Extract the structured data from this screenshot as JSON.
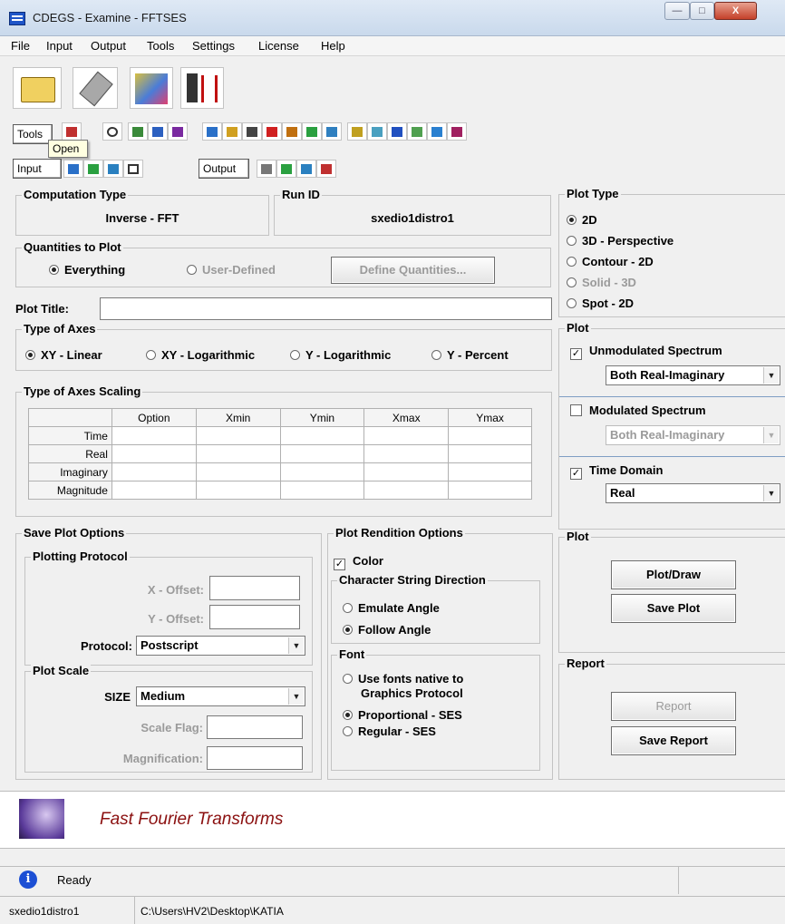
{
  "window": {
    "title": "CDEGS - Examine - FFTSES",
    "close_label": "X"
  },
  "menu": [
    "File",
    "Input",
    "Output",
    "Tools",
    "Settings",
    "License",
    "Help"
  ],
  "toolbar": {
    "tools_label": "Tools",
    "input_label": "Input",
    "output_label": "Output",
    "tooltip": "Open"
  },
  "computation_type": {
    "title": "Computation Type",
    "value": "Inverse - FFT"
  },
  "run_id": {
    "title": "Run ID",
    "value": "sxedio1distro1"
  },
  "quantities": {
    "title": "Quantities to Plot",
    "everything": "Everything",
    "user_defined": "User-Defined",
    "define_button": "Define Quantities..."
  },
  "plot_title": {
    "label": "Plot Title:",
    "value": ""
  },
  "axes_type": {
    "title": "Type of Axes",
    "options": [
      "XY - Linear",
      "XY - Logarithmic",
      "Y - Logarithmic",
      "Y - Percent"
    ]
  },
  "axes_scaling": {
    "title": "Type of Axes Scaling",
    "columns": [
      "",
      "Option",
      "Xmin",
      "Ymin",
      "Xmax",
      "Ymax"
    ],
    "rows": [
      "Time",
      "Real",
      "Imaginary",
      "Magnitude"
    ]
  },
  "plot_type": {
    "title": "Plot Type",
    "options": [
      "2D",
      "3D - Perspective",
      "Contour - 2D",
      "Solid - 3D",
      "Spot - 2D"
    ]
  },
  "plot_panel": {
    "title": "Plot",
    "unmodulated": "Unmodulated Spectrum",
    "unmodulated_value": "Both Real-Imaginary",
    "modulated": "Modulated Spectrum",
    "modulated_value": "Both Real-Imaginary",
    "time_domain": "Time Domain",
    "time_domain_value": "Real"
  },
  "save_plot_options": {
    "title": "Save Plot Options",
    "protocol_group": "Plotting Protocol",
    "x_offset": "X - Offset:",
    "y_offset": "Y - Offset:",
    "protocol_label": "Protocol:",
    "protocol_value": "Postscript",
    "scale_group": "Plot Scale",
    "size_label": "SIZE",
    "size_value": "Medium",
    "scale_flag": "Scale Flag:",
    "magnification": "Magnification:"
  },
  "rendition": {
    "title": "Plot Rendition Options",
    "color": "Color",
    "direction_group": "Character String Direction",
    "emulate": "Emulate Angle",
    "follow": "Follow Angle",
    "font_group": "Font",
    "native": "Use fonts native to",
    "native2": "Graphics Protocol",
    "proportional": "Proportional - SES",
    "regular": "Regular - SES"
  },
  "plot_actions": {
    "title": "Plot",
    "draw": "Plot/Draw",
    "save": "Save Plot"
  },
  "report": {
    "title": "Report",
    "report": "Report",
    "save": "Save Report"
  },
  "banner": {
    "text": "Fast Fourier Transforms"
  },
  "status": {
    "text": "Ready",
    "file": "sxedio1distro1",
    "path": "C:\\Users\\HV2\\Desktop\\KATIA"
  },
  "colors": {
    "banner_text": "#8b1010",
    "title_gradient": "#c9d9ec"
  }
}
